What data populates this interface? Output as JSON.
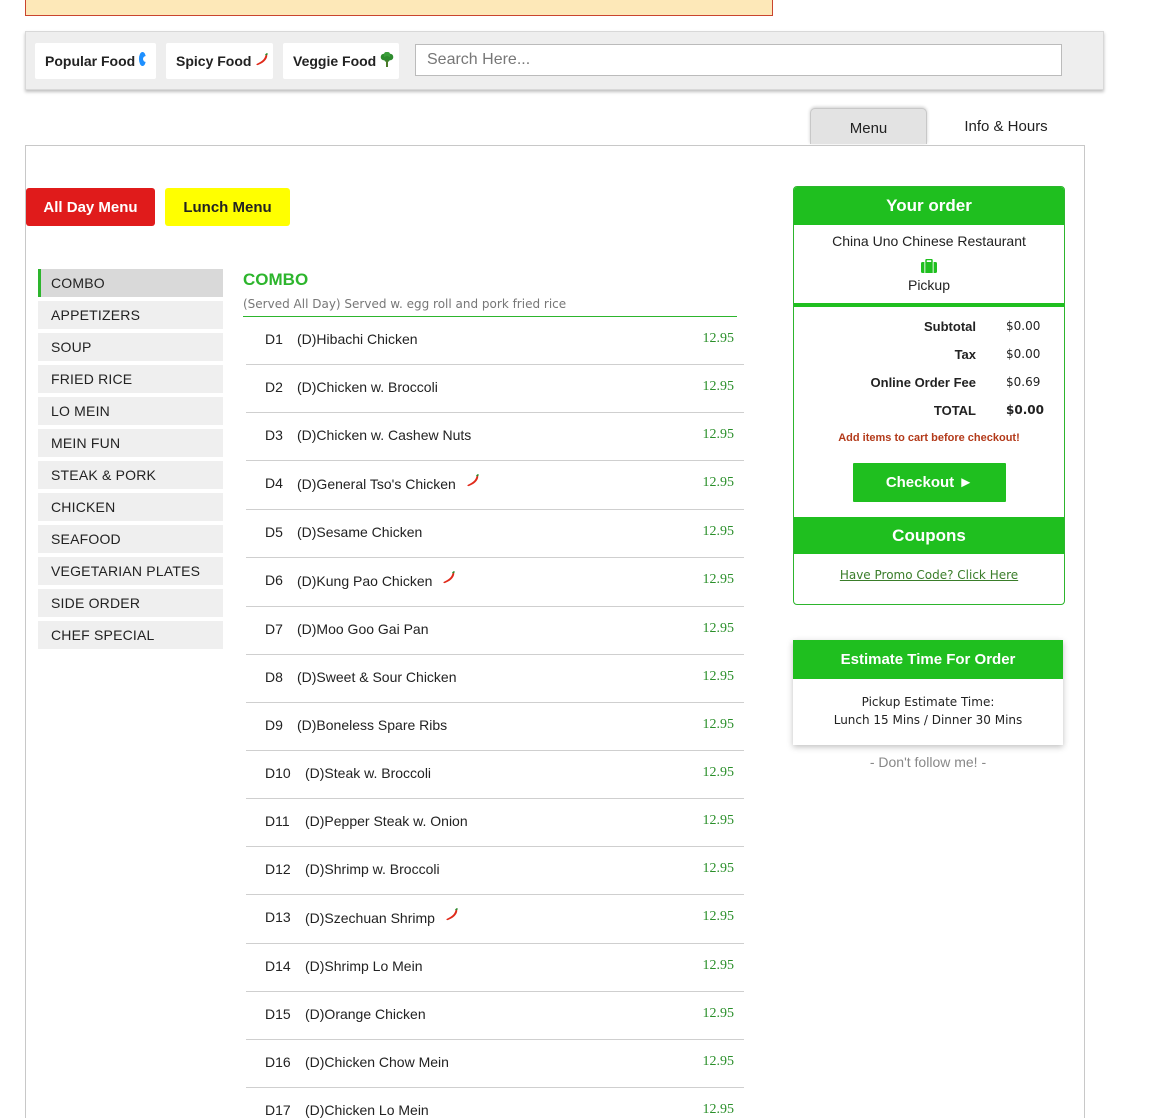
{
  "filters": {
    "popular_label": "Popular Food",
    "spicy_label": "Spicy Food",
    "veggie_label": "Veggie Food",
    "search_placeholder": "Search Here...",
    "icons": {
      "popular": "target-dot-icon",
      "spicy": "chili-icon",
      "veggie": "broccoli-icon"
    }
  },
  "tabs": {
    "menu": "Menu",
    "info": "Info & Hours"
  },
  "menu_buttons": {
    "all_day": "All Day Menu",
    "lunch": "Lunch Menu"
  },
  "sidebar": {
    "items": [
      "COMBO",
      "APPETIZERS",
      "SOUP",
      "FRIED RICE",
      "LO MEIN",
      "MEIN FUN",
      "STEAK & PORK",
      "CHICKEN",
      "SEAFOOD",
      "VEGETARIAN PLATES",
      "SIDE ORDER",
      "CHEF SPECIAL"
    ],
    "active": "COMBO"
  },
  "section": {
    "title": "COMBO",
    "description": "(Served All Day) Served w. egg roll and pork fried rice"
  },
  "items": [
    {
      "code": "D1",
      "name": "(D)Hibachi Chicken",
      "price": "12.95",
      "spicy": false
    },
    {
      "code": "D2",
      "name": "(D)Chicken w. Broccoli",
      "price": "12.95",
      "spicy": false
    },
    {
      "code": "D3",
      "name": "(D)Chicken w. Cashew Nuts",
      "price": "12.95",
      "spicy": false
    },
    {
      "code": "D4",
      "name": "(D)General Tso's Chicken",
      "price": "12.95",
      "spicy": true
    },
    {
      "code": "D5",
      "name": "(D)Sesame Chicken",
      "price": "12.95",
      "spicy": false
    },
    {
      "code": "D6",
      "name": "(D)Kung Pao Chicken",
      "price": "12.95",
      "spicy": true
    },
    {
      "code": "D7",
      "name": "(D)Moo Goo Gai Pan",
      "price": "12.95",
      "spicy": false
    },
    {
      "code": "D8",
      "name": "(D)Sweet & Sour Chicken",
      "price": "12.95",
      "spicy": false
    },
    {
      "code": "D9",
      "name": "(D)Boneless Spare Ribs",
      "price": "12.95",
      "spicy": false
    },
    {
      "code": "D10",
      "name": "(D)Steak w. Broccoli",
      "price": "12.95",
      "spicy": false
    },
    {
      "code": "D11",
      "name": "(D)Pepper Steak w. Onion",
      "price": "12.95",
      "spicy": false
    },
    {
      "code": "D12",
      "name": "(D)Shrimp w. Broccoli",
      "price": "12.95",
      "spicy": false
    },
    {
      "code": "D13",
      "name": "(D)Szechuan Shrimp",
      "price": "12.95",
      "spicy": true
    },
    {
      "code": "D14",
      "name": "(D)Shrimp Lo Mein",
      "price": "12.95",
      "spicy": false
    },
    {
      "code": "D15",
      "name": "(D)Orange Chicken",
      "price": "12.95",
      "spicy": false
    },
    {
      "code": "D16",
      "name": "(D)Chicken Chow Mein",
      "price": "12.95",
      "spicy": false
    },
    {
      "code": "D17",
      "name": "(D)Chicken Lo Mein",
      "price": "12.95",
      "spicy": false
    }
  ],
  "order": {
    "title": "Your order",
    "restaurant": "China Uno Chinese Restaurant",
    "mode": "Pickup",
    "subtotal_label": "Subtotal",
    "subtotal": "$0.00",
    "tax_label": "Tax",
    "tax": "$0.00",
    "fee_label": "Online Order Fee",
    "fee": "$0.69",
    "total_label": "TOTAL",
    "total": "$0.00",
    "warning": "Add items to cart before checkout!",
    "checkout_label": "Checkout ►",
    "coupons_title": "Coupons",
    "promo_link": "Have Promo Code? Click Here"
  },
  "estimate": {
    "title": "Estimate Time For Order",
    "line1": "Pickup Estimate Time:",
    "line2": "Lunch 15 Mins / Dinner 30 Mins"
  },
  "footer_note": "- Don't follow me! -",
  "colors": {
    "accent_green": "#1fbf1f",
    "all_day_red": "#e01b1b",
    "lunch_yellow": "#ffff00",
    "price_green": "#2a8f2a"
  }
}
